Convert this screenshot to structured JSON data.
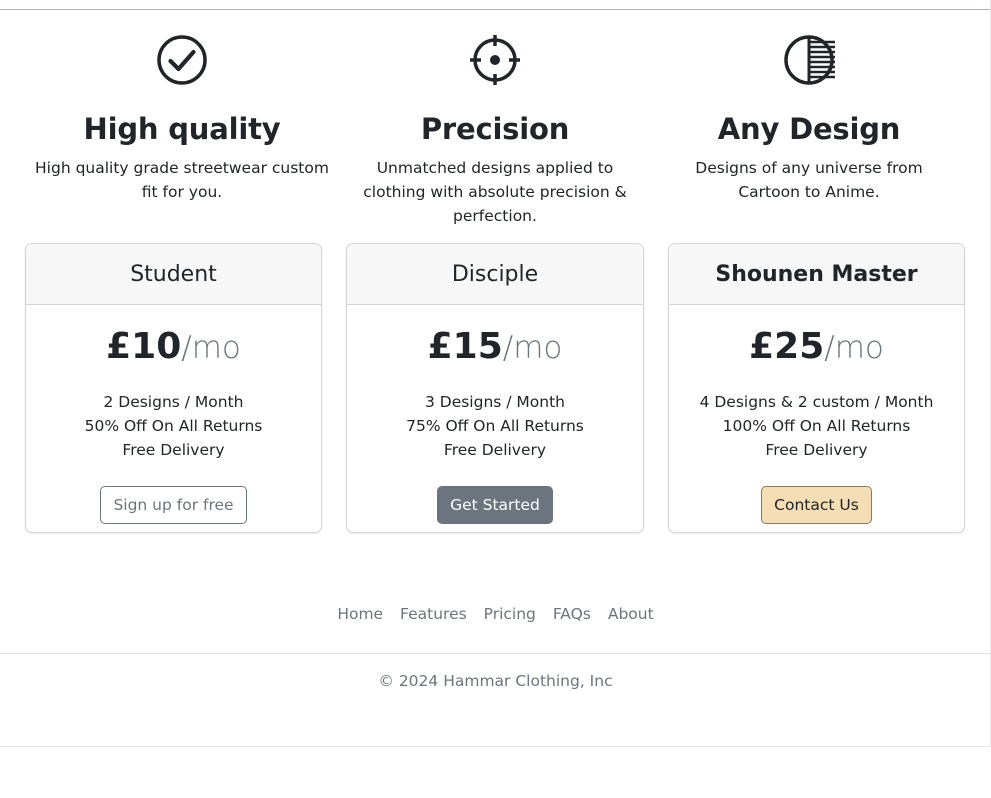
{
  "features": [
    {
      "icon": "check-circle-icon",
      "title": "High quality",
      "text": "High quality grade streetwear custom fit for you."
    },
    {
      "icon": "crosshair-icon",
      "title": "Precision",
      "text": "Unmatched designs applied to clothing with absolute precision & perfection."
    },
    {
      "icon": "half-striped-circle-icon",
      "title": "Any Design",
      "text": "Designs of any universe from Cartoon to Anime."
    }
  ],
  "plans": [
    {
      "name": "Student",
      "price": "£10",
      "per": "/mo",
      "items": [
        "2 Designs / Month",
        "50% Off On All Returns",
        "Free Delivery"
      ],
      "button": "Sign up for free"
    },
    {
      "name": "Disciple",
      "price": "£15",
      "per": "/mo",
      "items": [
        "3 Designs / Month",
        "75% Off On All Returns",
        "Free Delivery"
      ],
      "button": "Get Started"
    },
    {
      "name": "Shounen Master",
      "price": "£25",
      "per": "/mo",
      "items": [
        "4 Designs & 2 custom / Month",
        "100% Off On All Returns",
        "Free Delivery"
      ],
      "button": "Contact Us"
    }
  ],
  "footer": {
    "nav": [
      "Home",
      "Features",
      "Pricing",
      "FAQs",
      "About"
    ],
    "copyright": "© 2024 Hammar Clothing, Inc"
  },
  "colors": {
    "contact_button": "#f5deb3",
    "secondary_button": "#6c757d",
    "muted_text": "#6c757d"
  }
}
